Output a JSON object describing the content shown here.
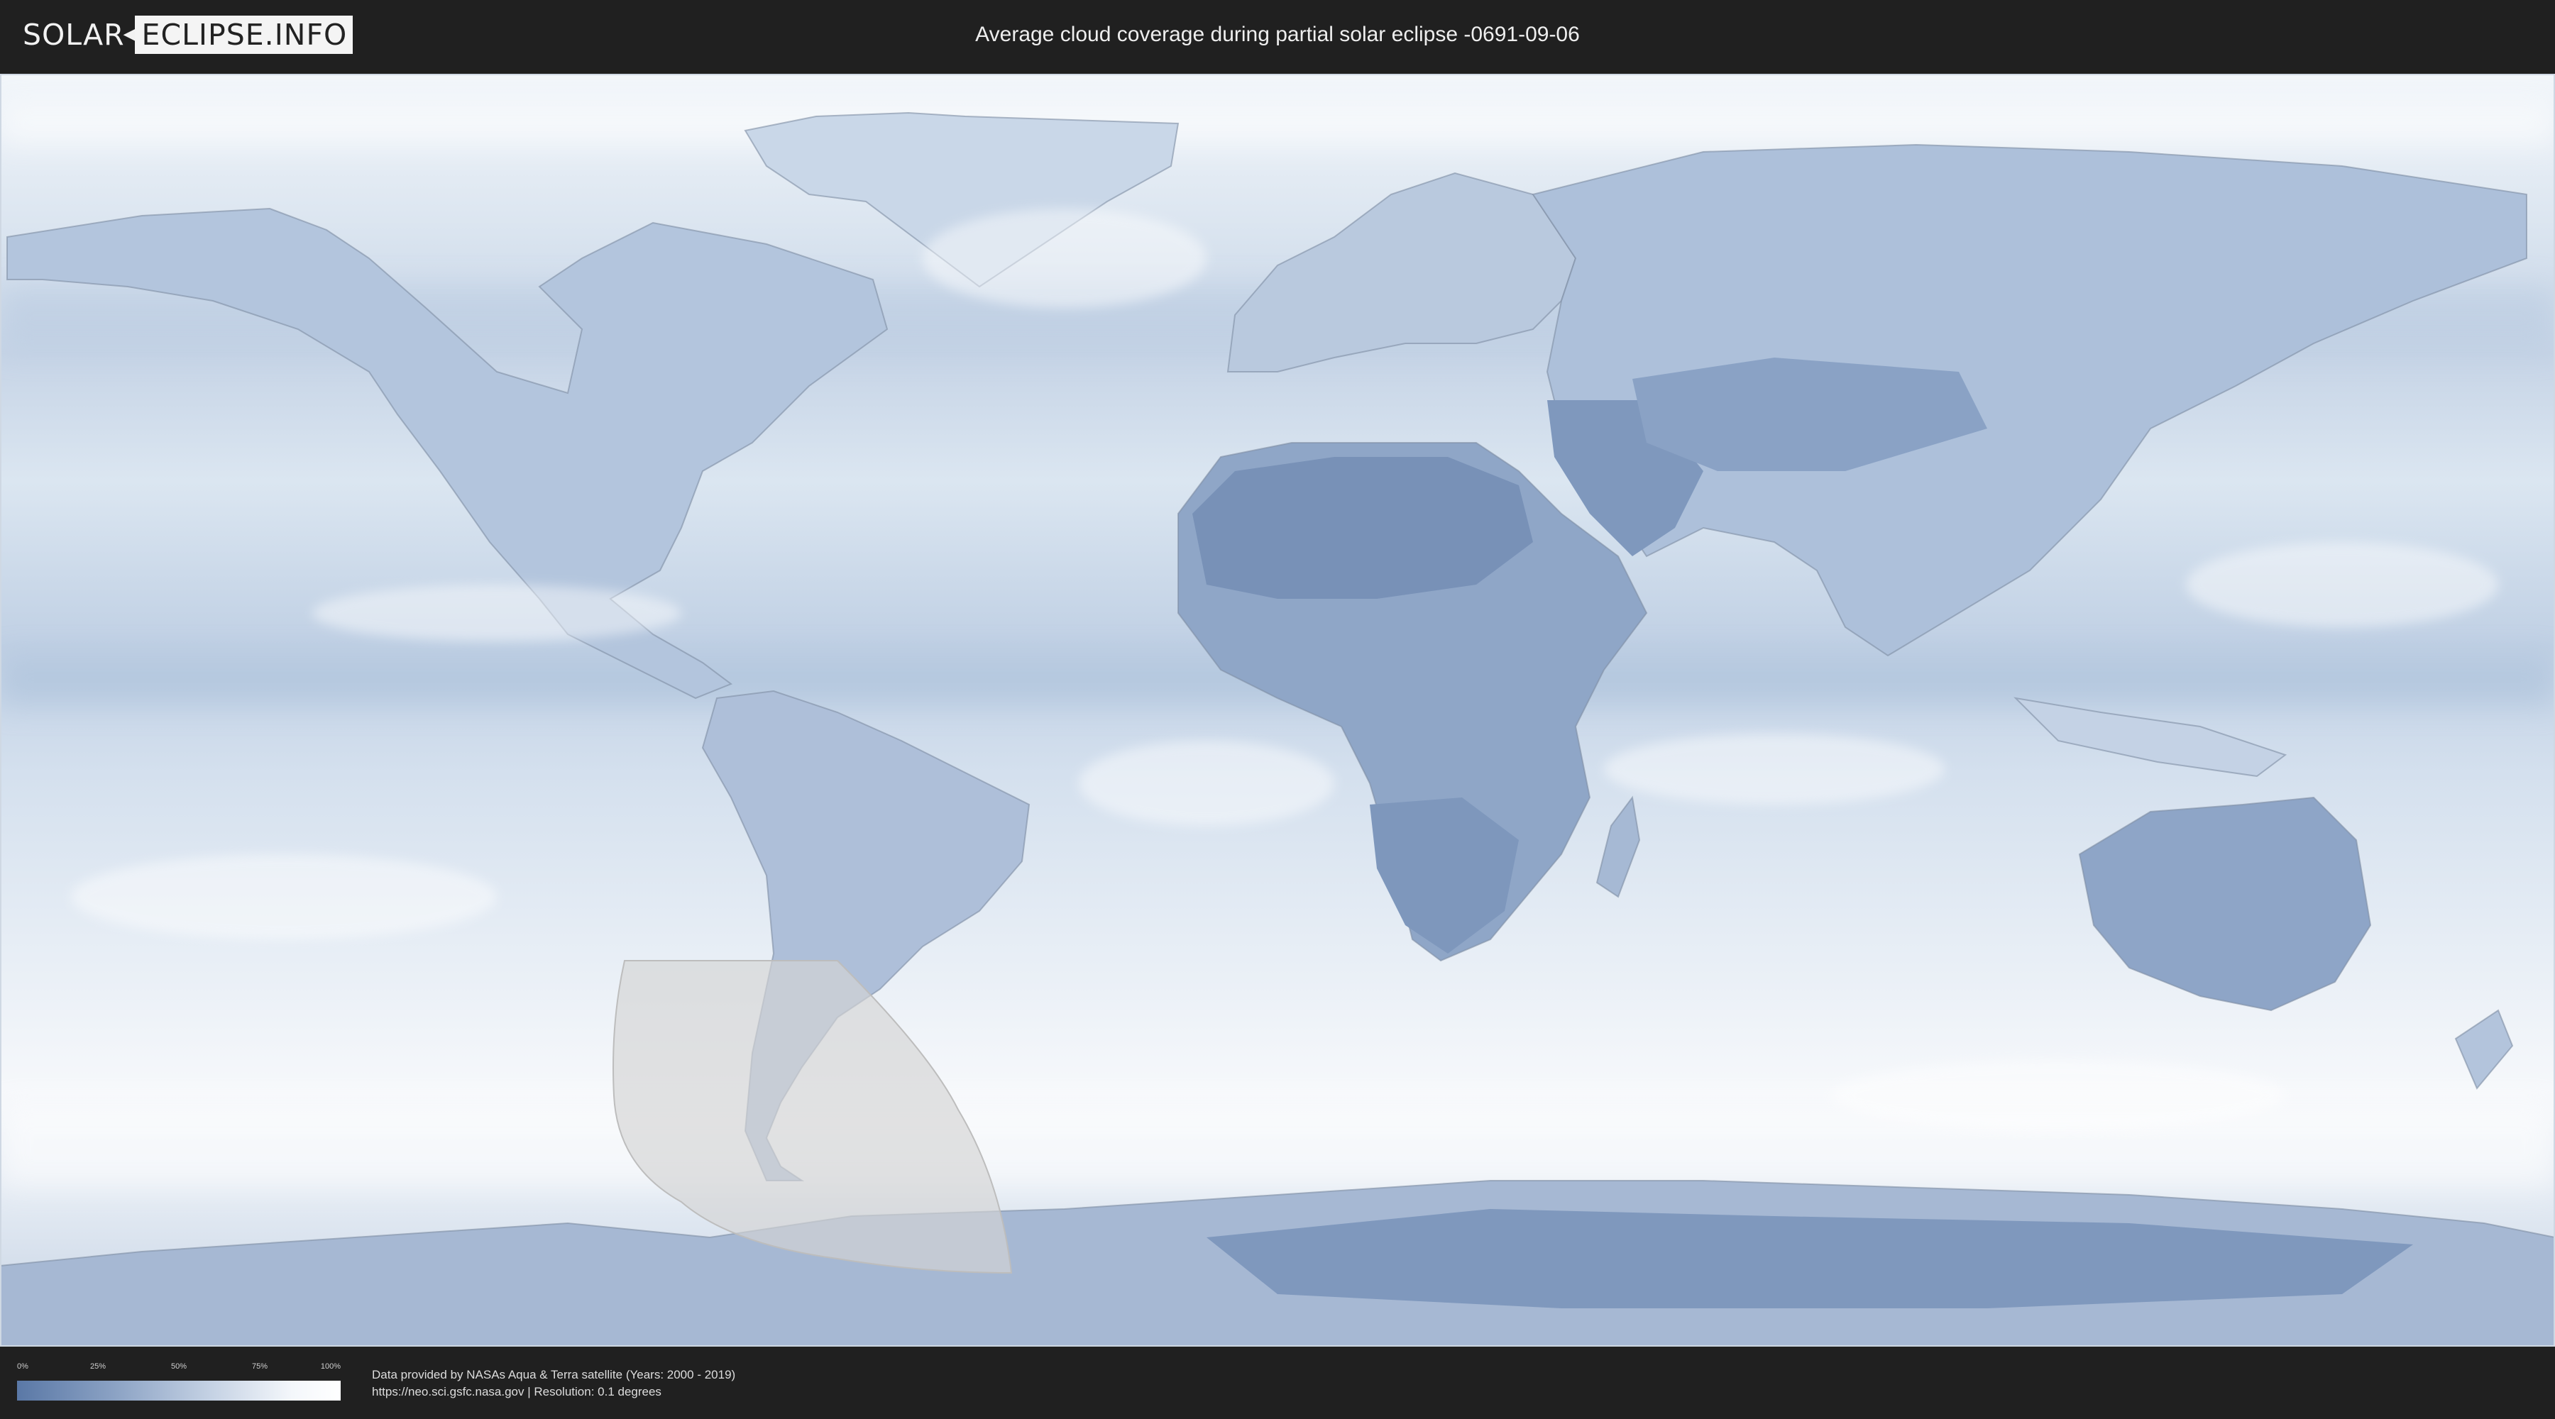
{
  "header": {
    "logo_left": "SOLAR",
    "logo_right": "ECLIPSE.INFO",
    "title": "Average cloud coverage during partial solar eclipse -0691-09-06"
  },
  "map": {
    "type": "world cloud coverage map",
    "colors": {
      "ocean_background": "#e9eff6",
      "low_cloud": "#5a78a6",
      "high_cloud": "#ffffff",
      "eclipse_path": "#cfcfcf"
    }
  },
  "legend": {
    "ticks": [
      "0%",
      "25%",
      "50%",
      "75%",
      "100%"
    ]
  },
  "footer": {
    "line1": "Data provided by NASAs Aqua & Terra satellite (Years: 2000 - 2019)",
    "line2": "https://neo.sci.gsfc.nasa.gov | Resolution: 0.1 degrees"
  }
}
